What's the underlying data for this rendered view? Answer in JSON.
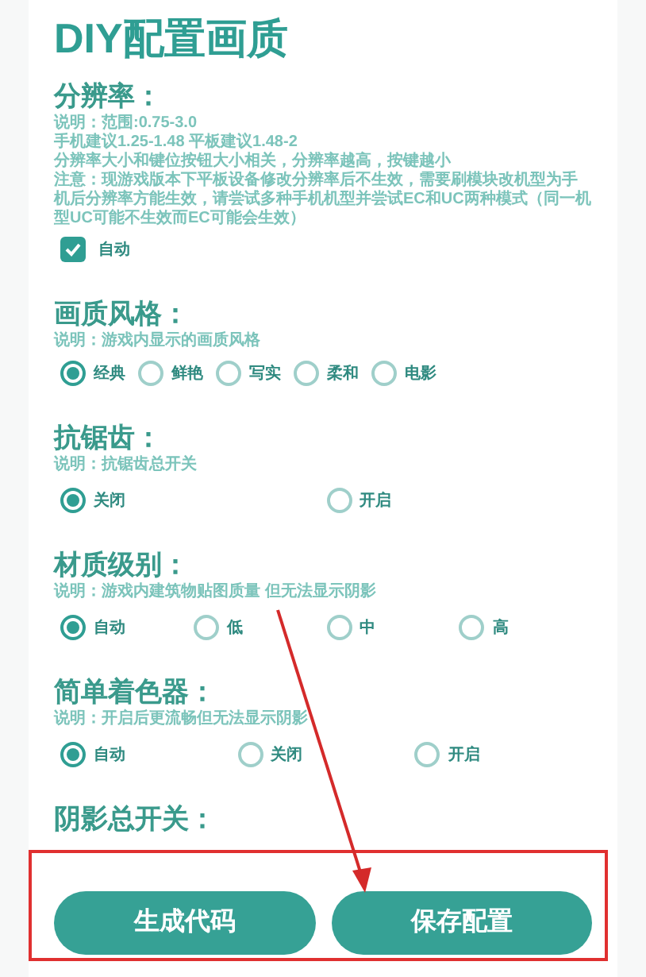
{
  "title": "DIY配置画质",
  "sections": [
    {
      "heading": "分辨率：",
      "kind": "checkbox",
      "description": [
        "说明：范围:0.75-3.0",
        "手机建议1.25-1.48  平板建议1.48-2",
        "分辨率大小和键位按钮大小相关，分辨率越高，按键越小",
        "注意：现游戏版本下平板设备修改分辨率后不生效，需要刷模块改机型为手机后分辨率方能生效，请尝试多种手机机型并尝试EC和UC两种模式（同一机型UC可能不生效而EC可能会生效）"
      ],
      "checkbox": {
        "label": "自动",
        "checked": true
      }
    },
    {
      "heading": "画质风格：",
      "kind": "radio_row",
      "description": [
        "说明：游戏内显示的画质风格"
      ],
      "options": [
        {
          "label": "经典",
          "selected": true
        },
        {
          "label": "鲜艳",
          "selected": false
        },
        {
          "label": "写实",
          "selected": false
        },
        {
          "label": "柔和",
          "selected": false
        },
        {
          "label": "电影",
          "selected": false
        }
      ]
    },
    {
      "heading": "抗锯齿：",
      "kind": "radio_grid",
      "description": [
        "说明：抗锯齿总开关"
      ],
      "options": [
        {
          "label": "关闭",
          "selected": true
        },
        {
          "label": "开启",
          "selected": false
        }
      ]
    },
    {
      "heading": "材质级别：",
      "kind": "radio_grid",
      "description": [
        "说明：游戏内建筑物贴图质量 但无法显示阴影"
      ],
      "options": [
        {
          "label": "自动",
          "selected": true
        },
        {
          "label": "低",
          "selected": false
        },
        {
          "label": "中",
          "selected": false
        },
        {
          "label": "高",
          "selected": false
        }
      ]
    },
    {
      "heading": "简单着色器：",
      "kind": "radio_grid",
      "description": [
        "说明：开启后更流畅但无法显示阴影"
      ],
      "options": [
        {
          "label": "自动",
          "selected": true
        },
        {
          "label": "关闭",
          "selected": false
        },
        {
          "label": "开启",
          "selected": false
        }
      ]
    },
    {
      "heading": "阴影总开关：",
      "kind": "heading_only"
    }
  ],
  "buttons": [
    "生成代码",
    "保存配置"
  ]
}
